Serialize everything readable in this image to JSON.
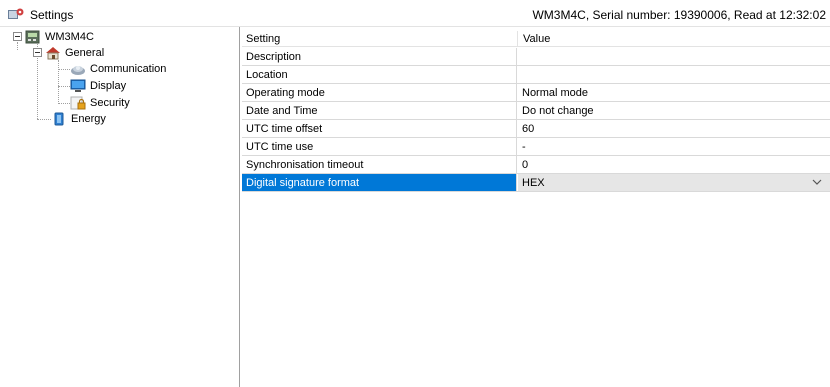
{
  "window": {
    "title": "Settings",
    "status": "WM3M4C, Serial number: 19390006, Read at 12:32:02"
  },
  "tree": {
    "root": {
      "label": "WM3M4C",
      "icon": "device-icon"
    },
    "general": {
      "label": "General",
      "icon": "house-icon"
    },
    "communication": {
      "label": "Communication",
      "icon": "network-icon"
    },
    "display": {
      "label": "Display",
      "icon": "monitor-icon"
    },
    "security": {
      "label": "Security",
      "icon": "lock-icon"
    },
    "energy": {
      "label": "Energy",
      "icon": "battery-icon"
    }
  },
  "grid": {
    "columns": [
      "Setting",
      "Value"
    ],
    "rows": [
      {
        "setting": "Description",
        "value": ""
      },
      {
        "setting": "Location",
        "value": ""
      },
      {
        "setting": "Operating mode",
        "value": "Normal mode"
      },
      {
        "setting": "Date and Time",
        "value": "Do not change"
      },
      {
        "setting": "UTC time offset",
        "value": "60"
      },
      {
        "setting": "UTC time use",
        "value": "-"
      },
      {
        "setting": "Synchronisation timeout",
        "value": "0"
      },
      {
        "setting": "Digital signature format",
        "value": "HEX"
      }
    ],
    "selected_row": 7
  },
  "colors": {
    "selection": "#0078d7",
    "grid_lines": "#d9d9d9"
  }
}
